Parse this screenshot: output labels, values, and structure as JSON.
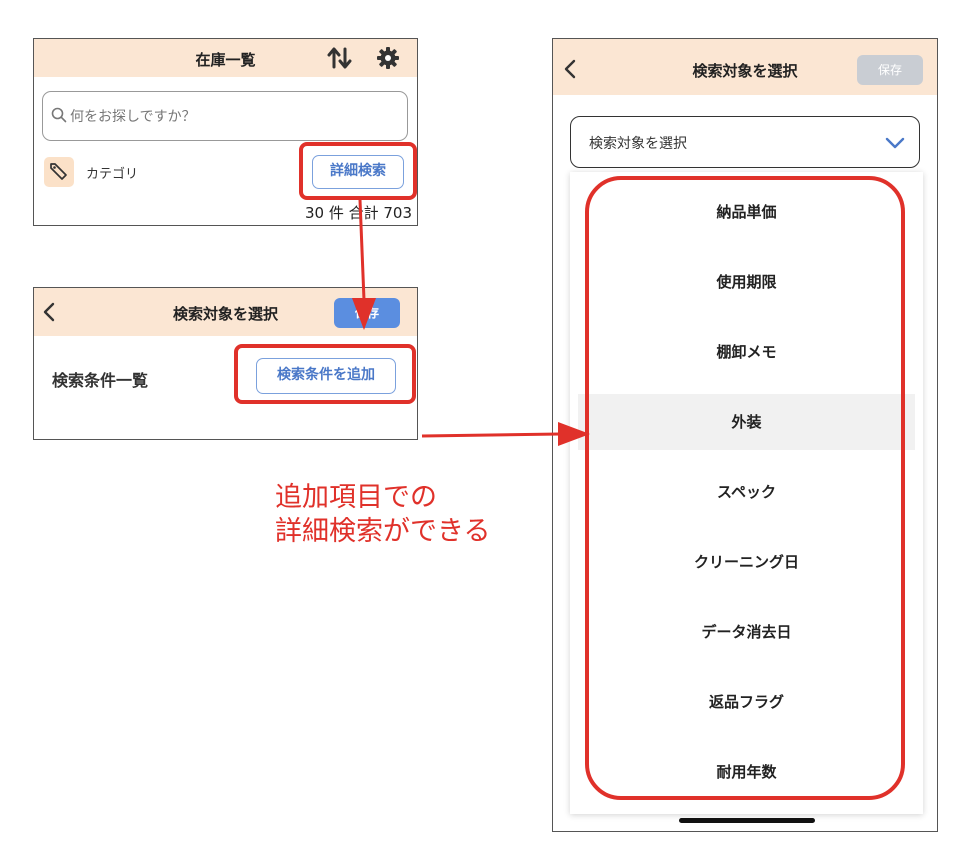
{
  "panel_inventory": {
    "title": "在庫一覧",
    "search_placeholder": "何をお探しですか？",
    "category_label": "カテゴリ",
    "detail_search_button": "詳細検索",
    "count_text": "30 件 合計 703"
  },
  "panel_conditions": {
    "title": "検索対象を選択",
    "save_button": "保存",
    "conditions_label": "検索条件一覧",
    "add_condition_button": "検索条件を追加"
  },
  "annotation": {
    "line1": "追加項目での",
    "line2": "詳細検索ができる",
    "color": "#e0312a"
  },
  "panel_select": {
    "title": "検索対象を選択",
    "save_button": "保存",
    "dropdown_value": "検索対象を選択",
    "items": [
      "納品単価",
      "使用期限",
      "棚卸メモ",
      "外装",
      "スペック",
      "クリーニング日",
      "データ消去日",
      "返品フラグ",
      "耐用年数"
    ],
    "highlighted_item": "外装"
  },
  "colors": {
    "header_bg": "#fbe6d3",
    "accent_blue": "#5b8ee0",
    "highlight_red": "#e0312a"
  }
}
